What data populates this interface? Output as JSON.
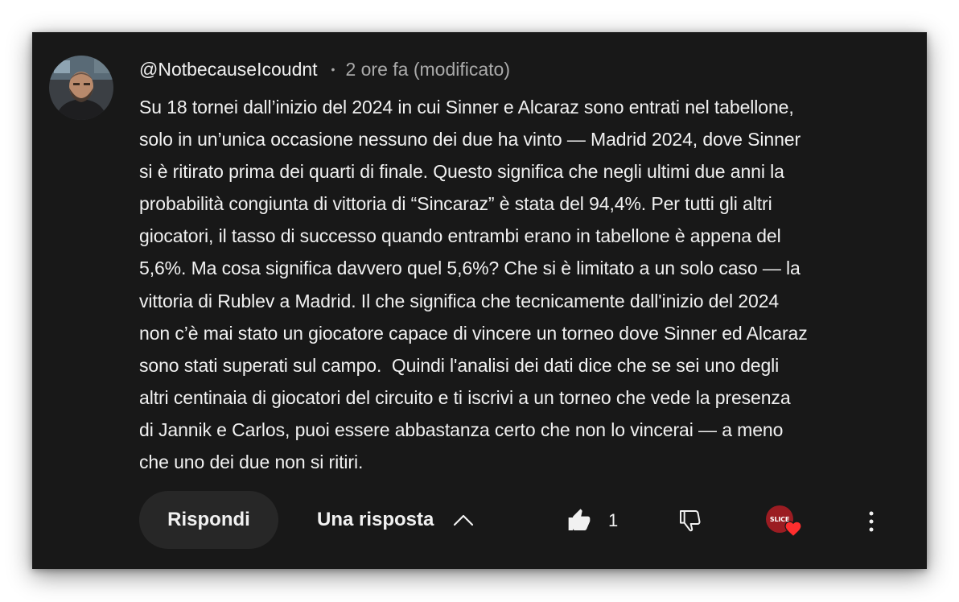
{
  "comment": {
    "author_handle": "@NotbecauseIcoudnt",
    "separator": "•",
    "timestamp": "2 ore fa (modificato)",
    "body": "Su 18 tornei dall’inizio del 2024 in cui Sinner e Alcaraz sono entrati nel tabellone,\nsolo in un’unica occasione nessuno dei due ha vinto — Madrid 2024, dove Sinner\nsi è ritirato prima dei quarti di finale. Questo significa che negli ultimi due anni la\nprobabilità congiunta di vittoria di “Sincaraz” è stata del 94,4%. Per tutti gli altri\ngiocatori, il tasso di successo quando entrambi erano in tabellone è appena del\n5,6%. Ma cosa significa davvero quel 5,6%? Che si è limitato a un solo caso — la\nvittoria di Rublev a Madrid. Il che significa che tecnicamente dall'inizio del 2024\nnon c’è mai stato un giocatore capace di vincere un torneo dove Sinner ed Alcaraz\nsono stati superati sul campo.  Quindi l'analisi dei dati dice che se sei uno degli\naltri centinaia di giocatori del circuito e ti iscrivi a un torneo che vede la presenza\ndi Jannik e Carlos, puoi essere abbastanza certo che non lo vincerai — a meno\nche uno dei due non si ritiri."
  },
  "actions": {
    "reply_label": "Rispondi",
    "replies_label": "Una risposta",
    "like_count": "1",
    "creator_badge_text": "SLICE"
  },
  "icons": {
    "avatar": "user-avatar",
    "expand": "chevron-up-icon",
    "like": "thumbs-up-filled-icon",
    "dislike": "thumbs-down-icon",
    "creator_heart": "creator-heart-icon",
    "more": "more-vert-icon"
  },
  "colors": {
    "background": "#181818",
    "text_primary": "#f1f1f1",
    "text_secondary": "#aaaaaa",
    "button_bg": "#272727",
    "heart": "#ff2e2e",
    "creator_avatar": "#9b1c22"
  }
}
